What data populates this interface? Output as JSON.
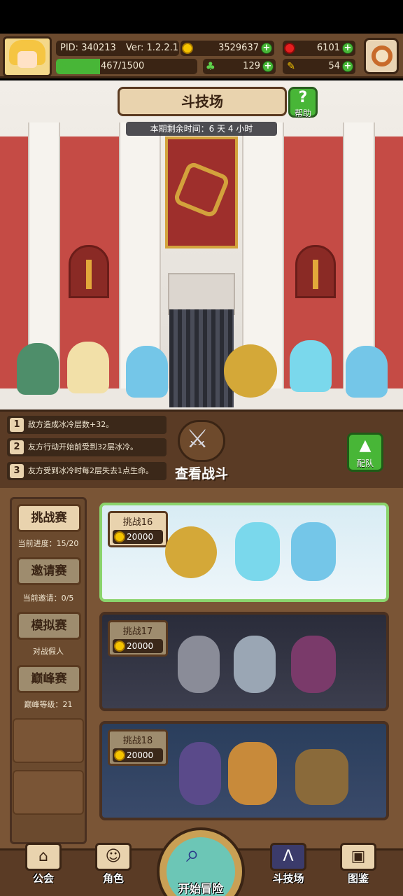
{
  "hud": {
    "pid": "PID: 340213",
    "version": "Ver: 1.2.2.1",
    "gold": "3529637",
    "gems": "6101",
    "stamina": "467/1500",
    "clover": "129",
    "keys": "54",
    "stamina_fraction": 0.311
  },
  "arena": {
    "title": "斗技场",
    "help_label": "帮助",
    "time_remaining": "本期剩余时间：6 天 4 小时"
  },
  "buffs": [
    {
      "num": "1",
      "text": "敌方造成冰冷层数+32。"
    },
    {
      "num": "2",
      "text": "友方行动开始前受到32层冰冷。"
    },
    {
      "num": "3",
      "text": "友方受到冰冷时每2层失去1点生命。"
    }
  ],
  "battle_button": "查看战斗",
  "team_button": "配队",
  "modes": [
    {
      "label": "挑战赛",
      "sub": "当前进度：15/20",
      "active": true
    },
    {
      "label": "邀请赛",
      "sub": "当前邀请：0/5",
      "active": false
    },
    {
      "label": "模拟赛",
      "sub": "对战假人",
      "active": false
    },
    {
      "label": "巅峰赛",
      "sub": "巅峰等级：21",
      "active": false
    }
  ],
  "challenges": [
    {
      "label": "挑战16",
      "cost": "20000"
    },
    {
      "label": "挑战17",
      "cost": "20000"
    },
    {
      "label": "挑战18",
      "cost": "20000"
    }
  ],
  "nav": {
    "guild": "公会",
    "character": "角色",
    "adventure": "开始冒险",
    "arena": "斗技场",
    "codex": "图鉴"
  },
  "colors": {
    "accent_green": "#48b637",
    "panel_brown": "#6b4a2e",
    "parchment": "#e9d3ae"
  }
}
